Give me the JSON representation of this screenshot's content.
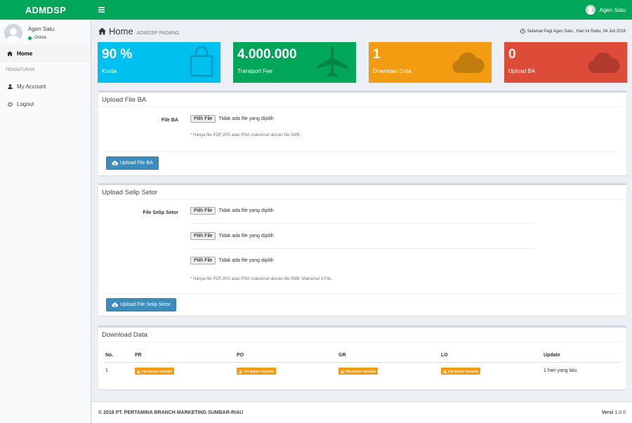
{
  "header": {
    "logo": "ADMDSP",
    "user_name": "Agen Satu"
  },
  "sidebar": {
    "user_name": "Agen Satu",
    "user_status": "Online",
    "items": [
      {
        "label": "Home",
        "icon": "home-icon"
      },
      {
        "label": "PENGATURAN"
      },
      {
        "label": "My Account",
        "icon": "user-icon"
      },
      {
        "label": "Logout",
        "icon": "power-icon"
      }
    ]
  },
  "page": {
    "title": "Home",
    "subtitle": "ADMDSP PADANG",
    "greeting": "Selamat Pagi Agen Satu.. Hari ini Rabu, 04 Juli 2018"
  },
  "stats": [
    {
      "value": "90 %",
      "label": "Kuota",
      "color": "#00c0ef",
      "icon": "shopping-bag-icon"
    },
    {
      "value": "4.000.000",
      "label": "Transport Fee",
      "color": "#00a65a",
      "icon": "plane-icon"
    },
    {
      "value": "1",
      "label": "Download Data",
      "color": "#f39c12",
      "icon": "cloud-icon"
    },
    {
      "value": "0",
      "label": "Upload BA",
      "color": "#dd4b39",
      "icon": "cloud-icon"
    }
  ],
  "upload_ba": {
    "title": "Upload File BA",
    "field_label": "File BA",
    "file_button": "Pilih File",
    "file_status": "Tidak ada file yang dipilih",
    "help": "* Hanya file PDF,JPG atau PNG maksimal ukuran file 5MB.",
    "submit": "Upload File BA"
  },
  "upload_setor": {
    "title": "Upload Selip Setor",
    "field_label": "File Selip Setor",
    "file_button": "Pilih File",
    "file_status": "Tidak ada file yang dipilih",
    "help": "* Hanya file PDF,JPG atau PNG maksimal ukuran file 5MB. Maksimal 3 File.",
    "submit": "Upload File Selip Setor"
  },
  "download": {
    "title": "Download Data",
    "columns": [
      "No.",
      "PR",
      "PO",
      "GR",
      "LO",
      "Update"
    ],
    "rows": [
      {
        "no": "1",
        "pr": "File Belum Tersedia",
        "po": "File Belum Tersedia",
        "gr": "File Belum Tersedia",
        "lo": "File Belum Tersedia",
        "update": "1 hari yang lalu"
      }
    ]
  },
  "footer": {
    "copyright": "© 2018 PT. PERTAMINA BRANCH MARKETING SUMBAR-RIAU",
    "version_label": "Versi",
    "version": "1.0.0"
  }
}
